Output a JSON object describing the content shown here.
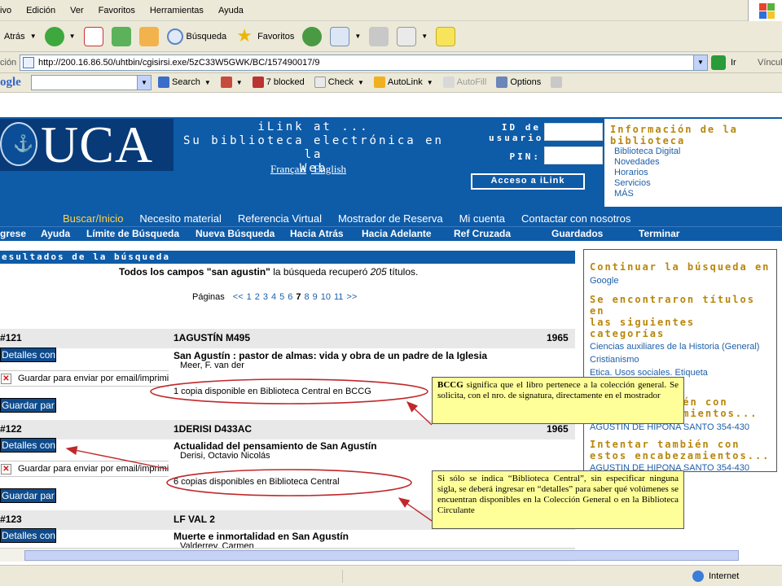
{
  "browser": {
    "menu": [
      "ivo",
      "Edición",
      "Ver",
      "Favoritos",
      "Herramientas",
      "Ayuda"
    ],
    "toolbar": {
      "back": "Atrás",
      "search": "Búsqueda",
      "favorites": "Favoritos"
    },
    "address": {
      "label": "ción",
      "url": "http://200.16.86.50/uhtbin/cgisirsi.exe/5zC33W5GWK/BC/157490017/9",
      "go": "Ir",
      "links": "Víncul"
    },
    "googlebar": {
      "logo": "ogle",
      "search": "Search",
      "blocked": "7 blocked",
      "check": "Check",
      "autolink": "AutoLink",
      "autofill": "AutoFill",
      "options": "Options"
    },
    "status": {
      "zone": "Internet"
    }
  },
  "header": {
    "logo_text": "UCA",
    "title_line1": "iLink at ...",
    "title_line2": "Su biblioteca electrónica en la",
    "title_line3": "Web",
    "lang_fr": "Français",
    "lang_en": "English",
    "user_id_label1": "ID de",
    "user_id_label2": "usuario:",
    "pin_label": "PIN:",
    "access_button": "Acceso a iLink",
    "info_title1": "Información de la",
    "info_title2": "biblioteca",
    "info_links": [
      "Biblioteca Digital",
      "Novedades",
      "Horarios",
      "Servicios",
      "MÁS"
    ]
  },
  "nav_primary": [
    "Buscar/Inicio",
    "Necesito material",
    "Referencia Virtual",
    "Mostrador de Reserva",
    "Mi cuenta",
    "Contactar con nosotros"
  ],
  "nav_secondary": [
    "grese",
    "Ayuda",
    "Límite de Búsqueda",
    "Nueva Búsqueda",
    "Hacia Atrás",
    "Hacia Adelante",
    "Ref Cruzada",
    "Guardados",
    "Terminar"
  ],
  "results": {
    "header": "esultados de la búsqueda",
    "summary_prefix": "Todos los campos \"san agustin\"",
    "summary_mid": " la búsqueda recuperó ",
    "summary_count": "205",
    "summary_suffix": " títulos.",
    "pages_label": "Páginas",
    "pages": [
      "<<",
      "1",
      "2",
      "3",
      "4",
      "5",
      "6",
      "7",
      "8",
      "9",
      "10",
      "11",
      ">>"
    ],
    "current_page": "7",
    "details_button": "Detalles con",
    "email_label": "Guardar para enviar por email/imprimir",
    "save_button": "Guardar par",
    "entries": [
      {
        "num": "121",
        "call": "1AGUSTÍN M495",
        "year": "1965",
        "title": "San Agustín : pastor de almas: vida y obra de un padre de la Iglesia",
        "author": "Meer, F. van der",
        "availability": "1 copia disponible en Biblioteca Central en BCCG"
      },
      {
        "num": "122",
        "call": "1DERISI D433AC",
        "year": "1965",
        "title": "Actualidad del pensamiento de San Agustín",
        "author": "Derisi, Octavio Nicolás",
        "availability": "6 copias disponibles en Biblioteca Central"
      },
      {
        "num": "123",
        "call": "LF VAL 2",
        "year": "",
        "title": "Muerte e inmortalidad en San Agustín",
        "author": "Valderrey, Carmen",
        "availability": ""
      }
    ]
  },
  "sidebar": {
    "continue_title1": "Continuar la búsqueda en",
    "continue_link": "Google",
    "found_title1": "Se encontraron títulos en",
    "found_title2": "las siguientes categorías",
    "categories": [
      "Ciencias auxiliares de la Historia (General)",
      "Cristianismo",
      "Etica. Usos sociales. Etiqueta",
      "Teología"
    ],
    "try_title_fragment": "ién con",
    "try_title_fragment2": "amientos...",
    "heading_link1": "AGUSTIN DE HIPONA SANTO 354-430",
    "try_title1": "Intentar también con",
    "try_title2": "estos encabezamientos...",
    "heading_link2": "AGUSTIN DE HIPONA SANTO 354-430"
  },
  "callouts": {
    "bccg_bold": "BCCG",
    "bccg_text": " significa que el libro pertenece a la colección general. Se solicita, con el nro. de signatura, directamente en el mostrador",
    "central_text": "Si sólo se indica “Biblioteca Central”, sin especificar ninguna sigla, se deberá ingresar en “detalles” para saber qué volúmenes se encuentran disponibles en la Colección General  o en la Biblioteca Circulante"
  },
  "colors": {
    "banner_blue": "#0e5ba8",
    "gold": "#b8860b",
    "link_blue": "#1e5fa8",
    "callout_yellow": "#ffff99",
    "annotation_red": "#c0282b"
  }
}
